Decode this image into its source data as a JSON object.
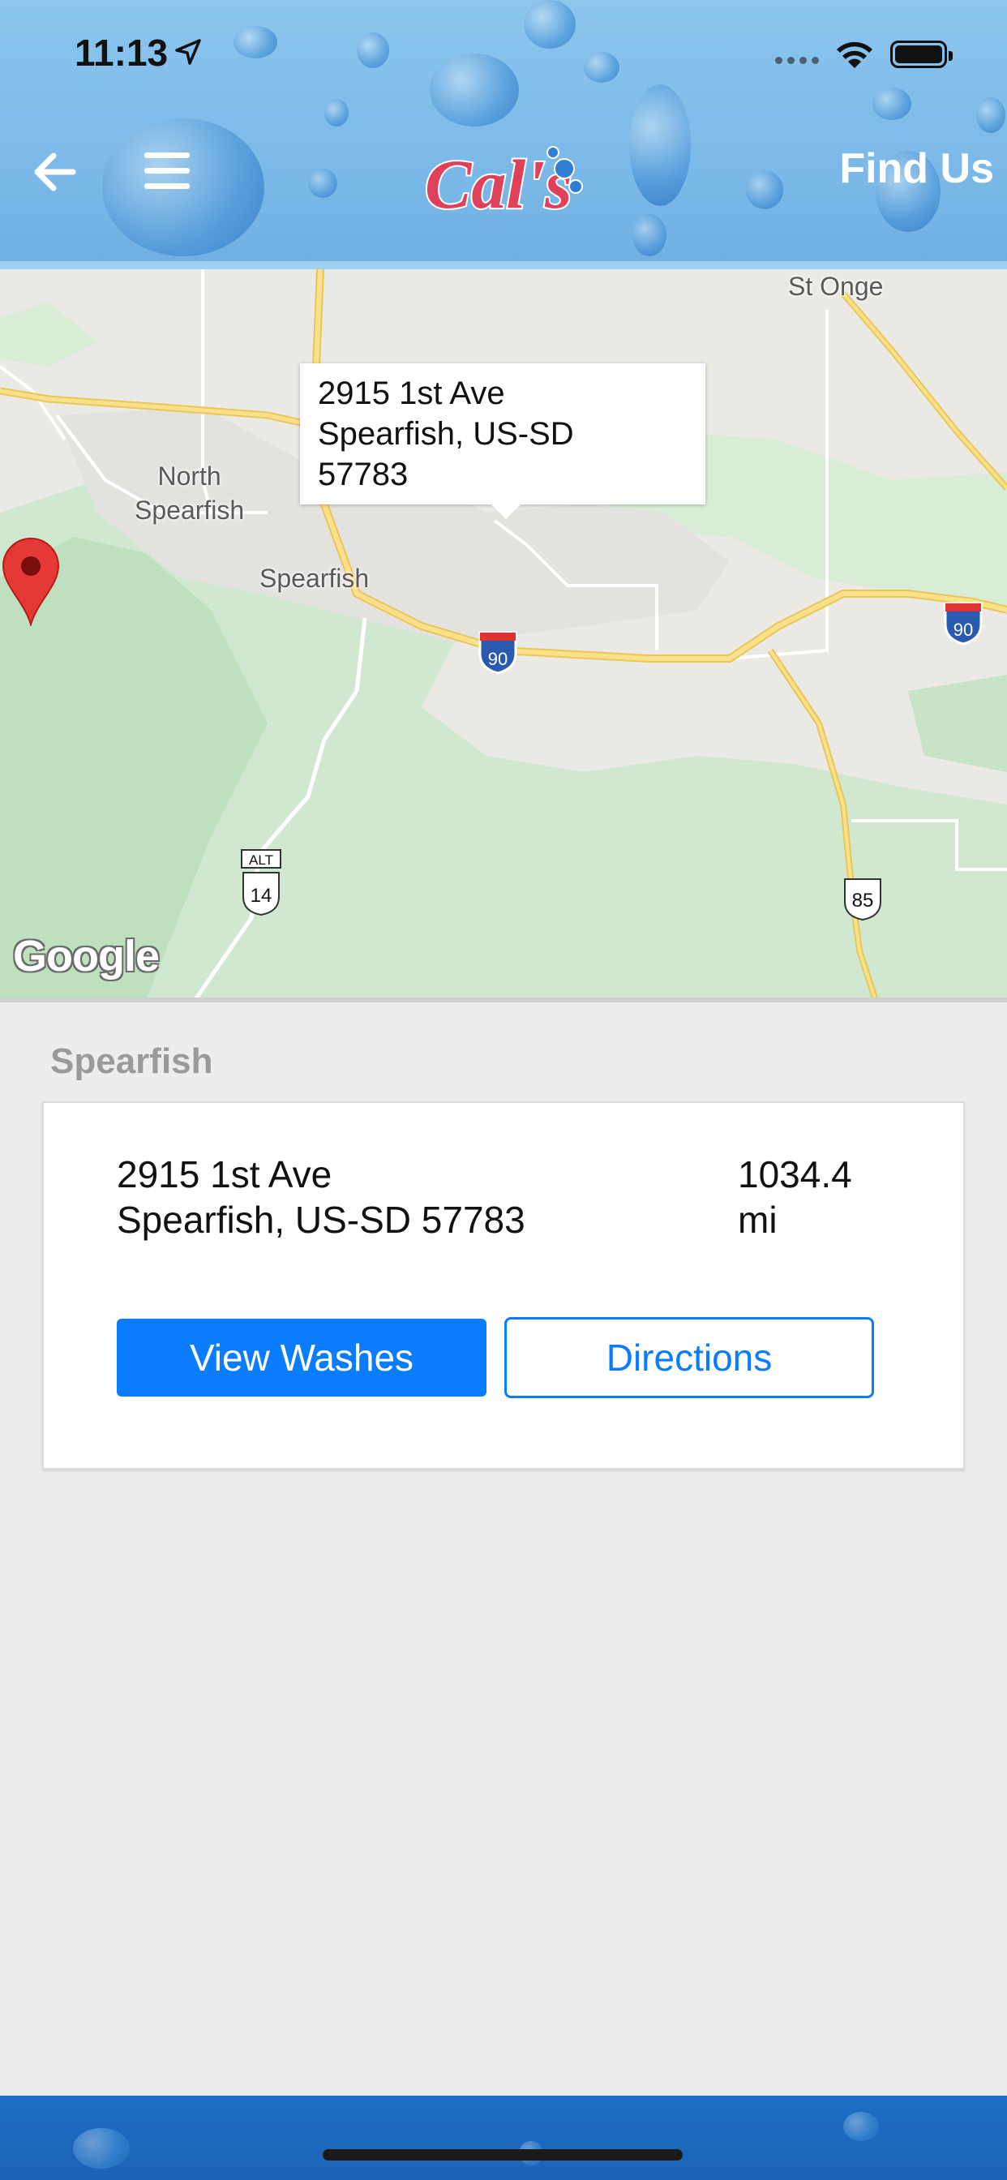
{
  "status_bar": {
    "time": "11:13",
    "location_icon": "location-arrow-icon",
    "signal_icon": "cellular-signal-icon",
    "wifi_icon": "wifi-icon",
    "battery_icon": "battery-icon"
  },
  "header": {
    "back_icon": "arrow-left-icon",
    "menu_icon": "hamburger-menu-icon",
    "logo_text": "Cal's",
    "title": "Find Us"
  },
  "map": {
    "callout": {
      "line1": "2915 1st Ave",
      "line2": "Spearfish, US-SD",
      "line3": "57783"
    },
    "labels": {
      "st_onge": "St Onge",
      "north_spearfish_1": "North",
      "north_spearfish_2": "Spearfish",
      "spearfish": "Spearfish"
    },
    "shields": {
      "i90_a": "90",
      "i90_b": "90",
      "alt": "ALT",
      "us14": "14",
      "us85": "85"
    },
    "attribution": "Google"
  },
  "location": {
    "section_title": "Spearfish",
    "address_line1": "2915 1st Ave",
    "address_line2": "Spearfish, US-SD  57783",
    "distance_value": "1034.4",
    "distance_unit": "mi",
    "view_washes_label": "View Washes",
    "directions_label": "Directions"
  },
  "colors": {
    "header_blue": "#79b7e7",
    "primary": "#0a7cff",
    "footer_blue": "#1d6fc7",
    "pin_red": "#e53935"
  }
}
